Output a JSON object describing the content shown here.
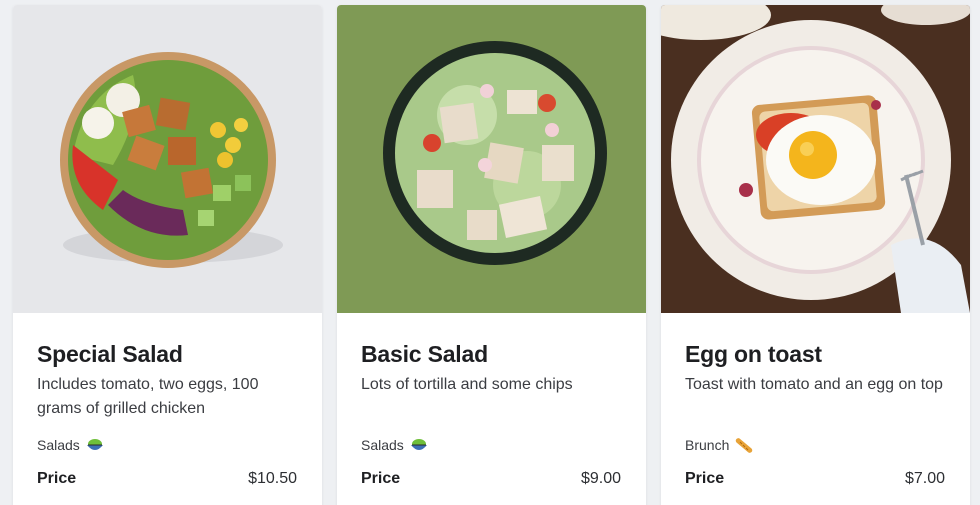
{
  "products": [
    {
      "title": "Special Salad",
      "description": "Includes tomato, two eggs, 100 grams of grilled chicken",
      "category": "Salads",
      "category_icon": "salad-icon",
      "price_label": "Price",
      "price": "$10.50",
      "image": "special-salad-photo"
    },
    {
      "title": "Basic Salad",
      "description": "Lots of tortilla and some chips",
      "category": "Salads",
      "category_icon": "salad-icon",
      "price_label": "Price",
      "price": "$9.00",
      "image": "basic-salad-photo"
    },
    {
      "title": "Egg on toast",
      "description": "Toast with tomato and an egg on top",
      "category": "Brunch",
      "category_icon": "baguette-icon",
      "price_label": "Price",
      "price": "$7.00",
      "image": "egg-on-toast-photo"
    }
  ]
}
